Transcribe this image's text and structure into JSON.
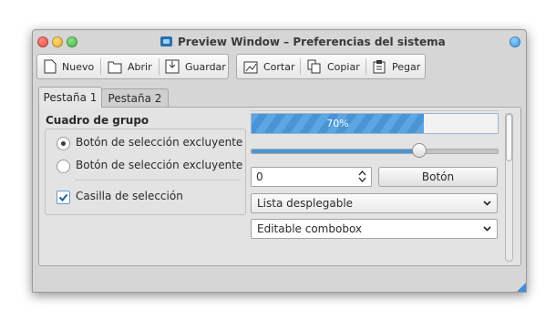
{
  "window": {
    "title": "Preview Window – Preferencias del sistema"
  },
  "toolbar": {
    "items": [
      {
        "label": "Nuevo",
        "icon": "new-document-icon"
      },
      {
        "label": "Abrir",
        "icon": "open-folder-icon"
      },
      {
        "label": "Guardar",
        "icon": "save-icon"
      },
      {
        "label": "Cortar",
        "icon": "cut-icon"
      },
      {
        "label": "Copiar",
        "icon": "copy-icon"
      },
      {
        "label": "Pegar",
        "icon": "paste-icon"
      }
    ]
  },
  "tabs": [
    {
      "label": "Pestaña 1",
      "active": true
    },
    {
      "label": "Pestaña 2",
      "active": false
    }
  ],
  "group": {
    "title": "Cuadro de grupo",
    "radio1": "Botón de selección excluyente",
    "radio2": "Botón de selección excluyente",
    "radio1_checked": true,
    "radio2_checked": false,
    "checkbox": "Casilla de selección",
    "checkbox_checked": true
  },
  "controls": {
    "progress_value": 70,
    "progress_text": "70%",
    "slider_value": 0.68,
    "spinbox_value": "0",
    "button_label": "Botón",
    "dropdown_value": "Lista desplegable",
    "combobox_value": "Editable combobox"
  },
  "colors": {
    "accent": "#4a94d6",
    "close": "#e0443e",
    "minimize": "#e9a824",
    "maximize": "#3fae3f"
  }
}
